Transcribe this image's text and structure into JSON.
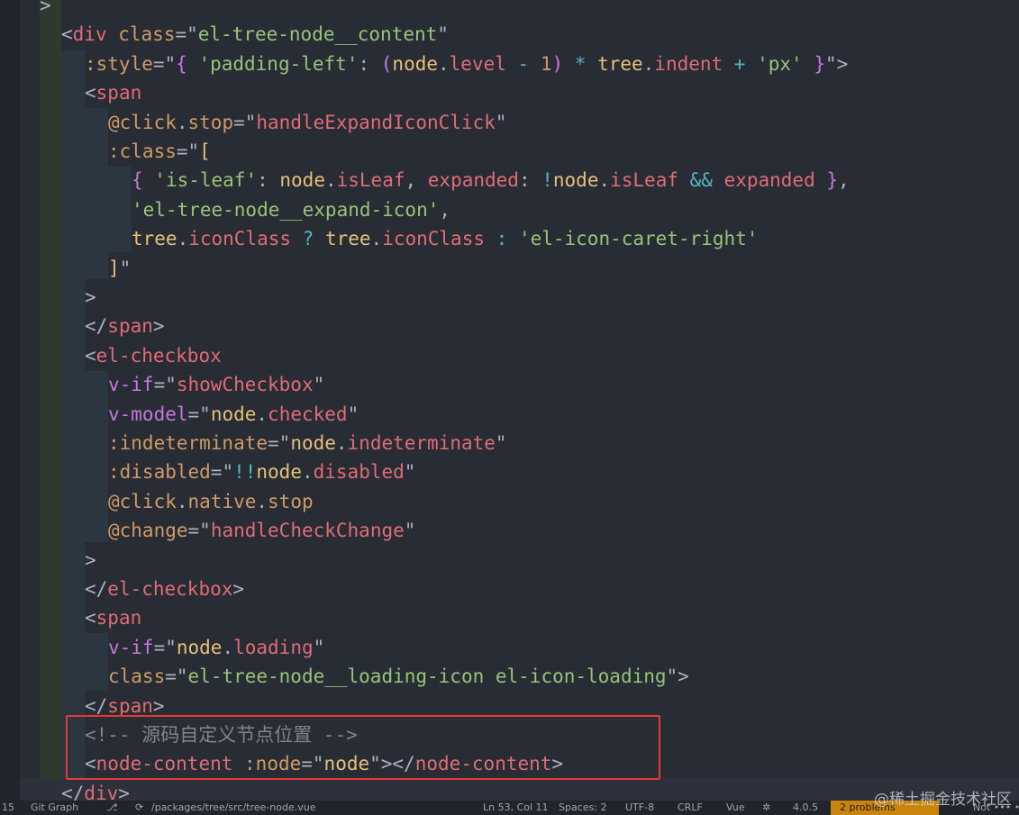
{
  "lines": [
    [
      {
        "t": ">",
        "c": "punct"
      }
    ],
    [
      {
        "t": "<",
        "c": "punct"
      },
      {
        "t": "div",
        "c": "tag"
      },
      {
        "t": " ",
        "c": "plain"
      },
      {
        "t": "class",
        "c": "attr"
      },
      {
        "t": "=\"",
        "c": "punct"
      },
      {
        "t": "el-tree-node__content",
        "c": "str"
      },
      {
        "t": "\"",
        "c": "punct"
      }
    ],
    [
      {
        "t": ":style",
        "c": "attr"
      },
      {
        "t": "=\"",
        "c": "punct"
      },
      {
        "t": "{ ",
        "c": "keyword"
      },
      {
        "t": "'padding-left'",
        "c": "str"
      },
      {
        "t": ": ",
        "c": "punct"
      },
      {
        "t": "(",
        "c": "keyword"
      },
      {
        "t": "node",
        "c": "var"
      },
      {
        "t": ".",
        "c": "punct"
      },
      {
        "t": "level",
        "c": "prop"
      },
      {
        "t": " - ",
        "c": "op"
      },
      {
        "t": "1",
        "c": "num"
      },
      {
        "t": ")",
        "c": "keyword"
      },
      {
        "t": " * ",
        "c": "op"
      },
      {
        "t": "tree",
        "c": "var"
      },
      {
        "t": ".",
        "c": "punct"
      },
      {
        "t": "indent",
        "c": "prop"
      },
      {
        "t": " + ",
        "c": "op"
      },
      {
        "t": "'px'",
        "c": "str"
      },
      {
        "t": " }",
        "c": "keyword"
      },
      {
        "t": "\">",
        "c": "punct"
      }
    ],
    [
      {
        "t": "<",
        "c": "punct"
      },
      {
        "t": "span",
        "c": "tag"
      }
    ],
    [
      {
        "t": "@click",
        "c": "attr"
      },
      {
        "t": ".",
        "c": "punct"
      },
      {
        "t": "stop",
        "c": "attr"
      },
      {
        "t": "=\"",
        "c": "punct"
      },
      {
        "t": "handleExpandIconClick",
        "c": "prop"
      },
      {
        "t": "\"",
        "c": "punct"
      }
    ],
    [
      {
        "t": ":class",
        "c": "attr"
      },
      {
        "t": "=\"",
        "c": "punct"
      },
      {
        "t": "[",
        "c": "var"
      }
    ],
    [
      {
        "t": "{ ",
        "c": "keyword"
      },
      {
        "t": "'is-leaf'",
        "c": "str"
      },
      {
        "t": ": ",
        "c": "punct"
      },
      {
        "t": "node",
        "c": "var"
      },
      {
        "t": ".",
        "c": "punct"
      },
      {
        "t": "isLeaf",
        "c": "prop"
      },
      {
        "t": ", ",
        "c": "punct"
      },
      {
        "t": "expanded",
        "c": "prop"
      },
      {
        "t": ": ",
        "c": "punct"
      },
      {
        "t": "!",
        "c": "op"
      },
      {
        "t": "node",
        "c": "var"
      },
      {
        "t": ".",
        "c": "punct"
      },
      {
        "t": "isLeaf",
        "c": "prop"
      },
      {
        "t": " && ",
        "c": "op"
      },
      {
        "t": "expanded",
        "c": "prop"
      },
      {
        "t": " }",
        "c": "keyword"
      },
      {
        "t": ",",
        "c": "punct"
      }
    ],
    [
      {
        "t": "'el-tree-node__expand-icon'",
        "c": "str"
      },
      {
        "t": ",",
        "c": "punct"
      }
    ],
    [
      {
        "t": "tree",
        "c": "var"
      },
      {
        "t": ".",
        "c": "punct"
      },
      {
        "t": "iconClass",
        "c": "prop"
      },
      {
        "t": " ? ",
        "c": "op"
      },
      {
        "t": "tree",
        "c": "var"
      },
      {
        "t": ".",
        "c": "punct"
      },
      {
        "t": "iconClass",
        "c": "prop"
      },
      {
        "t": " : ",
        "c": "op"
      },
      {
        "t": "'el-icon-caret-right'",
        "c": "str"
      }
    ],
    [
      {
        "t": "]",
        "c": "var"
      },
      {
        "t": "\"",
        "c": "punct"
      }
    ],
    [
      {
        "t": ">",
        "c": "punct"
      }
    ],
    [
      {
        "t": "</",
        "c": "punct"
      },
      {
        "t": "span",
        "c": "tag"
      },
      {
        "t": ">",
        "c": "punct"
      }
    ],
    [
      {
        "t": "<",
        "c": "punct"
      },
      {
        "t": "el-checkbox",
        "c": "tag"
      }
    ],
    [
      {
        "t": "v-if",
        "c": "keyword"
      },
      {
        "t": "=\"",
        "c": "punct"
      },
      {
        "t": "showCheckbox",
        "c": "prop"
      },
      {
        "t": "\"",
        "c": "punct"
      }
    ],
    [
      {
        "t": "v-model",
        "c": "keyword"
      },
      {
        "t": "=\"",
        "c": "punct"
      },
      {
        "t": "node",
        "c": "var"
      },
      {
        "t": ".",
        "c": "punct"
      },
      {
        "t": "checked",
        "c": "prop"
      },
      {
        "t": "\"",
        "c": "punct"
      }
    ],
    [
      {
        "t": ":indeterminate",
        "c": "attr"
      },
      {
        "t": "=\"",
        "c": "punct"
      },
      {
        "t": "node",
        "c": "var"
      },
      {
        "t": ".",
        "c": "punct"
      },
      {
        "t": "indeterminate",
        "c": "prop"
      },
      {
        "t": "\"",
        "c": "punct"
      }
    ],
    [
      {
        "t": ":disabled",
        "c": "attr"
      },
      {
        "t": "=\"",
        "c": "punct"
      },
      {
        "t": "!!",
        "c": "op"
      },
      {
        "t": "node",
        "c": "var"
      },
      {
        "t": ".",
        "c": "punct"
      },
      {
        "t": "disabled",
        "c": "prop"
      },
      {
        "t": "\"",
        "c": "punct"
      }
    ],
    [
      {
        "t": "@click",
        "c": "attr"
      },
      {
        "t": ".",
        "c": "punct"
      },
      {
        "t": "native",
        "c": "attr"
      },
      {
        "t": ".",
        "c": "punct"
      },
      {
        "t": "stop",
        "c": "attr"
      }
    ],
    [
      {
        "t": "@change",
        "c": "attr"
      },
      {
        "t": "=\"",
        "c": "punct"
      },
      {
        "t": "handleCheckChange",
        "c": "prop"
      },
      {
        "t": "\"",
        "c": "punct"
      }
    ],
    [
      {
        "t": ">",
        "c": "punct"
      }
    ],
    [
      {
        "t": "</",
        "c": "punct"
      },
      {
        "t": "el-checkbox",
        "c": "tag"
      },
      {
        "t": ">",
        "c": "punct"
      }
    ],
    [
      {
        "t": "<",
        "c": "punct"
      },
      {
        "t": "span",
        "c": "tag"
      }
    ],
    [
      {
        "t": "v-if",
        "c": "keyword"
      },
      {
        "t": "=\"",
        "c": "punct"
      },
      {
        "t": "node",
        "c": "var"
      },
      {
        "t": ".",
        "c": "punct"
      },
      {
        "t": "loading",
        "c": "prop"
      },
      {
        "t": "\"",
        "c": "punct"
      }
    ],
    [
      {
        "t": "class",
        "c": "attr"
      },
      {
        "t": "=\"",
        "c": "punct"
      },
      {
        "t": "el-tree-node__loading-icon el-icon-loading",
        "c": "str"
      },
      {
        "t": "\">",
        "c": "punct"
      }
    ],
    [
      {
        "t": "</",
        "c": "punct"
      },
      {
        "t": "span",
        "c": "tag"
      },
      {
        "t": ">",
        "c": "punct"
      }
    ],
    [
      {
        "t": "<!-- 源码自定义节点位置 -->",
        "c": "comment"
      }
    ],
    [
      {
        "t": "<",
        "c": "punct"
      },
      {
        "t": "node-content",
        "c": "tag"
      },
      {
        "t": " ",
        "c": "plain"
      },
      {
        "t": ":node",
        "c": "attr"
      },
      {
        "t": "=\"",
        "c": "punct"
      },
      {
        "t": "node",
        "c": "var"
      },
      {
        "t": "\"></",
        "c": "punct"
      },
      {
        "t": "node-content",
        "c": "tag"
      },
      {
        "t": ">",
        "c": "punct"
      }
    ],
    [
      {
        "t": "</",
        "c": "punct"
      },
      {
        "t": "div",
        "c": "tag"
      },
      {
        "t": ">",
        "c": "punct"
      }
    ]
  ],
  "statusbar": {
    "left_fragment": "15",
    "git_label": "Git Graph",
    "path_fragment": "/packages/tree/src/tree-node.vue",
    "position": "Ln 53, Col 11",
    "spaces": "Spaces: 2",
    "encoding": "UTF-8",
    "eol": "CRLF",
    "language": "Vue",
    "version": "4.0.5",
    "highlight_label": "2 problems",
    "right_fragment": "Not ••• • f"
  },
  "watermark": "@稀土掘金技术社区",
  "colors": {
    "editor_bg": "#282c34",
    "highlight_border": "#e53935",
    "statusbar_bg": "#21252b",
    "statusbar_highlight": "#c8840c"
  }
}
